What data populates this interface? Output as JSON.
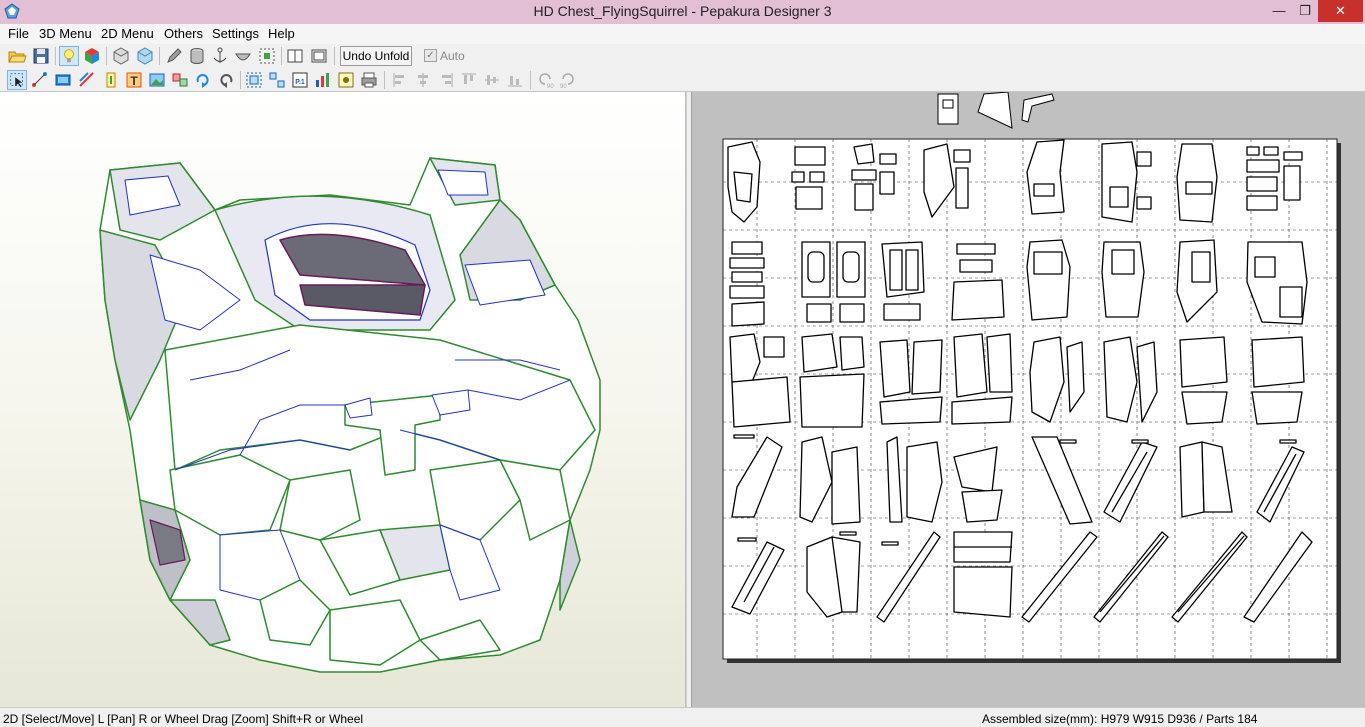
{
  "window": {
    "title": "HD Chest_FlyingSquirrel - Pepakura Designer 3",
    "min_glyph": "—",
    "max_glyph": "❐",
    "close_glyph": "✕"
  },
  "menu": {
    "items": [
      "File",
      "3D Menu",
      "2D Menu",
      "Others",
      "Settings",
      "Help"
    ]
  },
  "toolbar1": {
    "undo_unfold_label": "Undo Unfold",
    "auto_label": "Auto",
    "auto_checked": true,
    "icons": [
      "open-icon",
      "save-icon",
      "light-bulb-icon",
      "color-cube-icon",
      "cube-wire-icon",
      "cube-texture-icon",
      "pencil-icon",
      "cylinder-icon",
      "anchor-icon",
      "bowl-icon",
      "select-face-icon",
      "single-view-icon",
      "split-view-icon"
    ]
  },
  "toolbar2": {
    "icons": [
      "select-move-icon",
      "edge-icon",
      "texture-icon",
      "crease-icon",
      "flap-icon",
      "text-tool-icon",
      "image-tool-icon",
      "join-icon",
      "rotate-cw-icon",
      "rotate-ccw-icon",
      "layout-grid-icon",
      "layout-flip-icon",
      "page-p1-icon",
      "bar-chart-icon",
      "page-settings-icon",
      "print-icon",
      "align-left-icon",
      "align-center-icon",
      "align-right-icon",
      "align-top-icon",
      "align-middle-icon",
      "align-bottom-icon",
      "rotate-90-ccw-icon",
      "rotate-90-cw-icon"
    ]
  },
  "status": {
    "left": "2D [Select/Move] L [Pan] R or Wheel Drag [Zoom] Shift+R or Wheel",
    "right": "Assembled size(mm): H979 W915 D936 / Parts 184"
  },
  "colors": {
    "titlebar": "#e3bfd6",
    "close_button": "#c7302b",
    "model_edge_green": "#2e8b2e",
    "model_fold_blue": "#2233cc",
    "model_fold_purple": "#6a1a5a"
  }
}
